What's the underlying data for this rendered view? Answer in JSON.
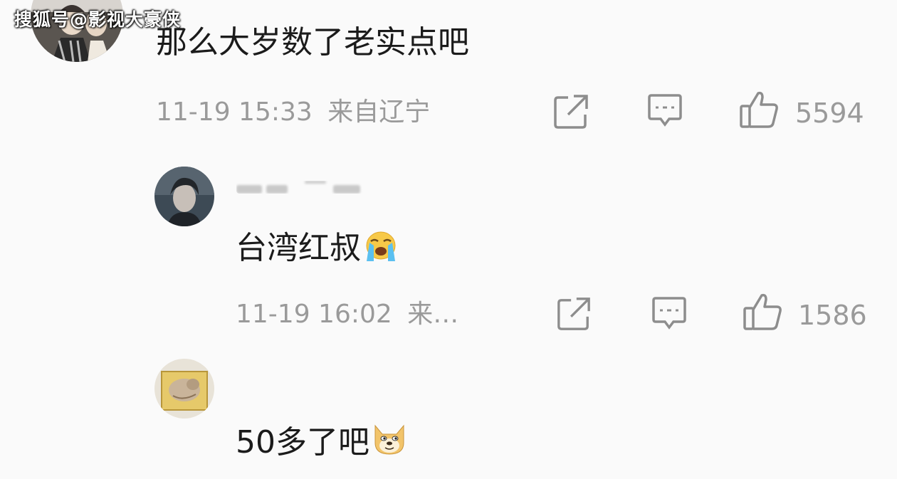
{
  "watermark": "搜狐号@影视大豪侠",
  "comments": [
    {
      "text": "那么大岁数了老实点吧",
      "date": "11-19 15:33",
      "location": "来自辽宁",
      "likes": "5594"
    },
    {
      "text": "台湾红叔",
      "emoji": "crying-emoji",
      "date": "11-19 16:02",
      "location": "来…",
      "likes": "1586"
    },
    {
      "text": "50多了吧",
      "emoji": "doge-emoji"
    }
  ],
  "icons": [
    "share-icon",
    "reply-icon",
    "like-icon"
  ],
  "colors": {
    "meta": "#9a9a9a",
    "text": "#1b1b1b",
    "background": "#fafafa"
  }
}
